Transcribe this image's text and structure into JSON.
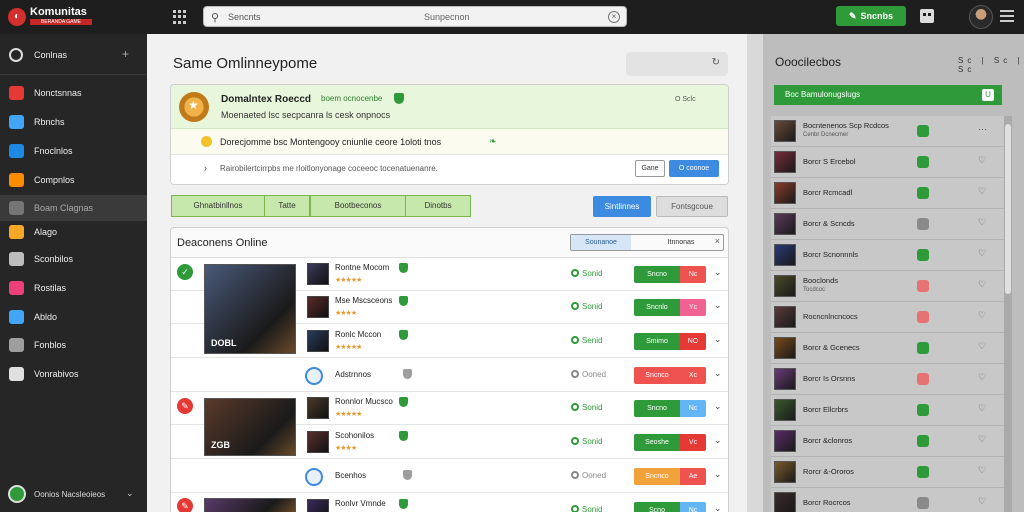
{
  "brand": {
    "name": "Komunitas",
    "tag": "BERANDA GAME",
    "icon": "flame-logo-icon",
    "color": "#d32f2f"
  },
  "topbar": {
    "search_left": "Sencnts",
    "search_placeholder": "Sunpecnon",
    "cta_label": "Sncnbs",
    "accent": "#2e9a3a"
  },
  "sidebar": {
    "header": "Conlnas",
    "items": [
      {
        "label": "Nonctsnnas",
        "icon": "home-icon",
        "color": "#e53935"
      },
      {
        "label": "Rbnchs",
        "icon": "gear-icon",
        "color": "#42a5f5"
      },
      {
        "label": "Fnoclnlos",
        "icon": "monitor-icon",
        "color": "#1e88e5"
      },
      {
        "label": "Compnlos",
        "icon": "bag-icon",
        "color": "#fb8c00"
      },
      {
        "label": "Boam Clagnas",
        "icon": "controller-icon",
        "color": "#757575"
      },
      {
        "label": "Alago",
        "icon": "ring-icon",
        "color": "#f9a825"
      },
      {
        "label": "Sconbilos",
        "icon": "chat-icon",
        "color": "#bdbdbd"
      },
      {
        "label": "Rostilas",
        "icon": "heart-icon",
        "color": "#ec407a"
      },
      {
        "label": "Abldo",
        "icon": "bell-icon",
        "color": "#42a5f5"
      },
      {
        "label": "Fonblos",
        "icon": "card-icon",
        "color": "#9e9e9e"
      },
      {
        "label": "Vonrabivos",
        "icon": "grid-icon",
        "color": "#e0e0e0"
      }
    ],
    "footer": "Oonios Nacsleoieos"
  },
  "main": {
    "title": "Same Omlinneypome",
    "promo": {
      "headline": "Domalntex Roeccd",
      "tag": "boem ocnocenbe",
      "sub": "Moenaeted lsc secpcanra ls cesk onpnocs",
      "link": "O Sclc",
      "line": "Dorecjomme bsc Montengooy cniunlie ceore 1oloti tnos",
      "note": "Rairobilertcirrpbs me rloitlonyonage coceeoc tocenatuenanre.",
      "btn_white": "Gane",
      "btn_blue": "O coonoe"
    },
    "filters": [
      "Ghnatbinllnos",
      "Tatte",
      "Bootbeconos",
      "Dinotbs"
    ],
    "actions": {
      "primary": "Sintlinnes",
      "secondary": "Fontsgcoue"
    },
    "list": {
      "title": "Deaconens Online",
      "seg_a": "Sounanoe",
      "seg_b": "Itnnonas",
      "rows": [
        {
          "title": "Rontne Mocom",
          "stars": "★★★★★",
          "status": "Sonid",
          "pill_l": "Sncno",
          "pill_r": "Nc",
          "pill_color": "#2e9a3a",
          "pill_r_color": "#ef5350",
          "kind": "thumb",
          "thumb_color": "#3b3b5a"
        },
        {
          "title": "Mse Mscsceons",
          "stars": "★★★★",
          "status": "Sonid",
          "pill_l": "Sncnlo",
          "pill_r": "Yc",
          "pill_color": "#2e9a3a",
          "pill_r_color": "#f06292",
          "kind": "thumb",
          "thumb_color": "#5a2a2a"
        },
        {
          "title": "Ronlc Mccon",
          "stars": "★★★★★",
          "status": "Senid",
          "pill_l": "Smimo",
          "pill_r": "NO",
          "pill_color": "#2e9a3a",
          "pill_r_color": "#e53935",
          "kind": "thumb",
          "thumb_color": "#2a3b5a"
        },
        {
          "title": "Adstrnnos",
          "stars": "",
          "status": "Ooned",
          "pill_l": "Sncnco",
          "pill_r": "Xc",
          "pill_color": "#ef5350",
          "pill_r_color": "#ef5350",
          "kind": "circle",
          "thumb_color": "#3d8be0"
        },
        {
          "title": "Ronnlor Mucsco",
          "stars": "★★★★★",
          "status": "Sonid",
          "pill_l": "Sncno",
          "pill_r": "Nc",
          "pill_color": "#2e9a3a",
          "pill_r_color": "#64b5f6",
          "kind": "thumb",
          "thumb_color": "#4a3a2a"
        },
        {
          "title": "Scohonilos",
          "stars": "★★★★",
          "status": "Sonid",
          "pill_l": "Seoshe",
          "pill_r": "Vc",
          "pill_color": "#2e9a3a",
          "pill_r_color": "#e53935",
          "kind": "thumb",
          "thumb_color": "#5a3030"
        },
        {
          "title": "Bcenhos",
          "stars": "",
          "status": "Ooned",
          "pill_l": "Sncnco",
          "pill_r": "Ae",
          "pill_color": "#f2a23a",
          "pill_r_color": "#ef5350",
          "kind": "circle",
          "thumb_color": "#3d8be0"
        },
        {
          "title": "Ronlvr Vmnde",
          "stars": "★★★★★",
          "status": "Sonid",
          "pill_l": "Scno",
          "pill_r": "Nc",
          "pill_color": "#2e9a3a",
          "pill_r_color": "#64b5f6",
          "kind": "thumb",
          "thumb_color": "#3a2a5a"
        }
      ],
      "feature_1": "DOBL",
      "feature_2": "ZGB"
    }
  },
  "rpanel": {
    "title": "Ooocilecbos",
    "controls": "Sc | Sc | Sc",
    "banner": "Boc Bamulonugslugs",
    "banner_btn": "U",
    "rows": [
      {
        "name": "Bocntenenos Scp Rcdcos",
        "meta": "Cenbr Dcnecmer",
        "badge": "#2e9a3a",
        "act": "⋯",
        "color": "#6b4a3a"
      },
      {
        "name": "Borcr S Ercebol",
        "meta": "",
        "badge": "#2e9a3a",
        "act": "♡",
        "color": "#7a2a3a"
      },
      {
        "name": "Borcr Rcmcadl",
        "meta": "",
        "badge": "#2e9a3a",
        "act": "♡",
        "color": "#8a3a2a"
      },
      {
        "name": "Borcr & Scncds",
        "meta": "",
        "badge": "#8a8a8a",
        "act": "♡",
        "color": "#5a3a5a"
      },
      {
        "name": "Borcr Scnonnnls",
        "meta": "",
        "badge": "#2e9a3a",
        "act": "♡",
        "color": "#2a3a7a"
      },
      {
        "name": "Booclonds",
        "meta": "Tocdcoc",
        "badge": "#e57373",
        "act": "♡",
        "color": "#4a4a2a"
      },
      {
        "name": "Rocncnlncncocs",
        "meta": "",
        "badge": "#e57373",
        "act": "♡",
        "color": "#5a3a3a"
      },
      {
        "name": "Borcr & Gcenecs",
        "meta": "",
        "badge": "#2e9a3a",
        "act": "♡",
        "color": "#7a4a1a"
      },
      {
        "name": "Borcr Is Orsnns",
        "meta": "",
        "badge": "#e57373",
        "act": "♡",
        "color": "#6a3a7a"
      },
      {
        "name": "Borcr Ellcrbrs",
        "meta": "",
        "badge": "#2e9a3a",
        "act": "♡",
        "color": "#3a5a2a"
      },
      {
        "name": "Borcr &clonros",
        "meta": "",
        "badge": "#2e9a3a",
        "act": "♡",
        "color": "#5a2a6a"
      },
      {
        "name": "Rorcr &-Ororos",
        "meta": "",
        "badge": "#2e9a3a",
        "act": "♡",
        "color": "#7a5a2a"
      },
      {
        "name": "Borcr Rocrcos",
        "meta": "",
        "badge": "#8a8a8a",
        "act": "♡",
        "color": "#3a2a2a"
      }
    ]
  }
}
